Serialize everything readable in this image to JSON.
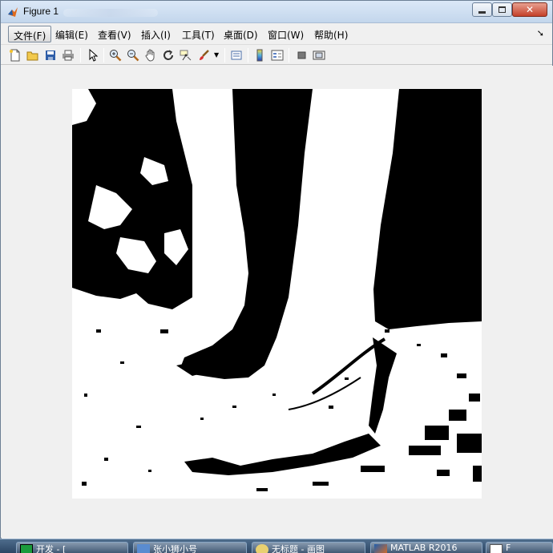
{
  "window": {
    "title": "Figure 1",
    "icon": "matlab-logo-icon"
  },
  "window_controls": {
    "minimize": "minimize-icon",
    "maximize": "maximize-icon",
    "close": "close-icon"
  },
  "menu": {
    "items": [
      {
        "label": "文件(F)"
      },
      {
        "label": "编辑(E)"
      },
      {
        "label": "查看(V)"
      },
      {
        "label": "插入(I)"
      },
      {
        "label": "工具(T)"
      },
      {
        "label": "桌面(D)"
      },
      {
        "label": "窗口(W)"
      },
      {
        "label": "帮助(H)"
      }
    ],
    "overflow_icon": "overflow-arrow-icon"
  },
  "toolbar": {
    "icons": [
      "new-figure-icon",
      "open-icon",
      "save-icon",
      "print-icon",
      "edit-plot-arrow-icon",
      "zoom-in-icon",
      "zoom-out-icon",
      "pan-hand-icon",
      "rotate-3d-icon",
      "data-cursor-icon",
      "brush-icon",
      "link-plot-icon",
      "colorbar-icon",
      "legend-icon",
      "hide-plot-tools-icon",
      "show-plot-tools-icon"
    ]
  },
  "figure": {
    "content": "binary-thresholded-image",
    "colors": {
      "foreground": "#000000",
      "background": "#ffffff"
    }
  },
  "taskbar": {
    "items": [
      {
        "label": "开发 - [",
        "icon": "pycharm-icon"
      },
      {
        "label": "张小狮小号",
        "icon": "app-icon"
      },
      {
        "label": "无标题 - 画图",
        "icon": "paint-icon"
      },
      {
        "label": "MATLAB R2016",
        "icon": "matlab-icon"
      },
      {
        "label": "F",
        "icon": "figure-icon"
      }
    ]
  },
  "colors": {
    "titlebar": "#c3d6ec",
    "window_bg": "#f0f0f0",
    "close_button": "#c4402a",
    "taskbar": "#2c4664"
  }
}
